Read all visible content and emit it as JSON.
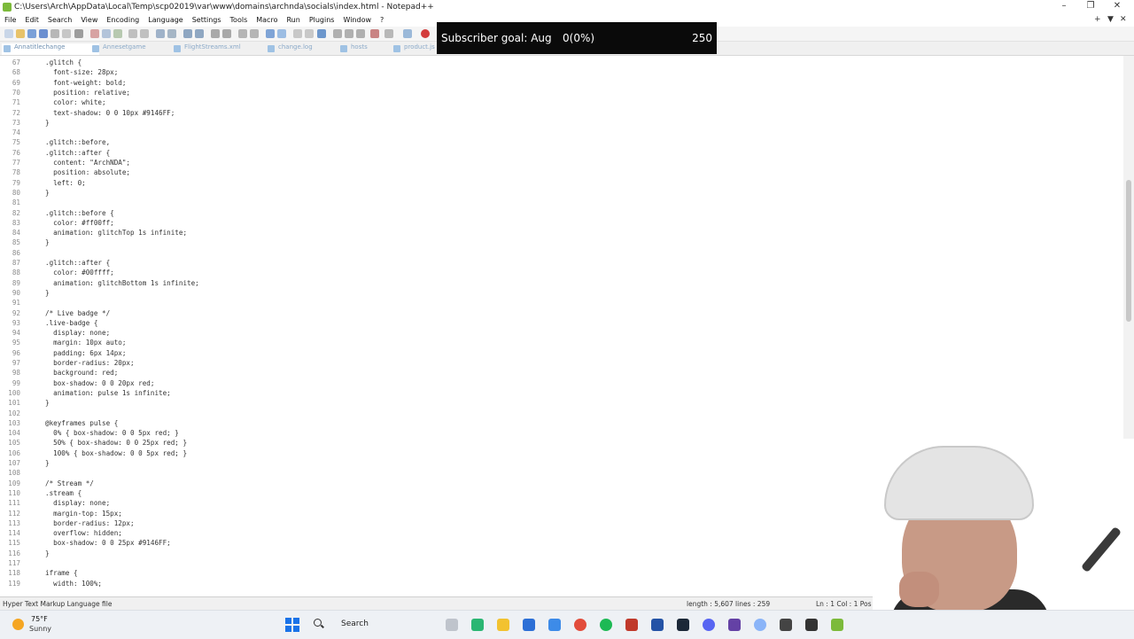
{
  "window": {
    "title": "C:\\Users\\Arch\\AppData\\Local\\Temp\\scp02019\\var\\www\\domains\\archnda\\socials\\index.html - Notepad++",
    "controls": [
      "–",
      "❐",
      "✕"
    ]
  },
  "menu": [
    "File",
    "Edit",
    "Search",
    "View",
    "Encoding",
    "Language",
    "Settings",
    "Tools",
    "Macro",
    "Run",
    "Plugins",
    "Window",
    "?"
  ],
  "menu_right": [
    "+",
    "▼",
    "✕"
  ],
  "tabs": [
    {
      "label": "Annatitlechange"
    },
    {
      "label": "Annesetgame"
    },
    {
      "label": "FlightStreams.xml"
    },
    {
      "label": "change.log"
    },
    {
      "label": "hosts"
    },
    {
      "label": "product.js"
    }
  ],
  "overlay": {
    "label": "Subscriber goal: Aug",
    "progress": "0(0%)",
    "goal": "250"
  },
  "code_lines": [
    {
      "n": "67",
      "t": ".glitch {"
    },
    {
      "n": "68",
      "t": "  font-size: 28px;"
    },
    {
      "n": "69",
      "t": "  font-weight: bold;"
    },
    {
      "n": "70",
      "t": "  position: relative;"
    },
    {
      "n": "71",
      "t": "  color: white;"
    },
    {
      "n": "72",
      "t": "  text-shadow: 0 0 10px #9146FF;"
    },
    {
      "n": "73",
      "t": "}"
    },
    {
      "n": "74",
      "t": ""
    },
    {
      "n": "75",
      "t": ".glitch::before,"
    },
    {
      "n": "76",
      "t": ".glitch::after {"
    },
    {
      "n": "77",
      "t": "  content: \"ArchNDA\";"
    },
    {
      "n": "78",
      "t": "  position: absolute;"
    },
    {
      "n": "79",
      "t": "  left: 0;"
    },
    {
      "n": "80",
      "t": "}"
    },
    {
      "n": "81",
      "t": ""
    },
    {
      "n": "82",
      "t": ".glitch::before {"
    },
    {
      "n": "83",
      "t": "  color: #ff00ff;"
    },
    {
      "n": "84",
      "t": "  animation: glitchTop 1s infinite;"
    },
    {
      "n": "85",
      "t": "}"
    },
    {
      "n": "86",
      "t": ""
    },
    {
      "n": "87",
      "t": ".glitch::after {"
    },
    {
      "n": "88",
      "t": "  color: #00ffff;"
    },
    {
      "n": "89",
      "t": "  animation: glitchBottom 1s infinite;"
    },
    {
      "n": "90",
      "t": "}"
    },
    {
      "n": "91",
      "t": ""
    },
    {
      "n": "92",
      "t": "/* Live badge */"
    },
    {
      "n": "93",
      "t": ".live-badge {"
    },
    {
      "n": "94",
      "t": "  display: none;"
    },
    {
      "n": "95",
      "t": "  margin: 10px auto;"
    },
    {
      "n": "96",
      "t": "  padding: 6px 14px;"
    },
    {
      "n": "97",
      "t": "  border-radius: 20px;"
    },
    {
      "n": "98",
      "t": "  background: red;"
    },
    {
      "n": "99",
      "t": "  box-shadow: 0 0 20px red;"
    },
    {
      "n": "100",
      "t": "  animation: pulse 1s infinite;"
    },
    {
      "n": "101",
      "t": "}"
    },
    {
      "n": "102",
      "t": ""
    },
    {
      "n": "103",
      "t": "@keyframes pulse {"
    },
    {
      "n": "104",
      "t": "  0% { box-shadow: 0 0 5px red; }"
    },
    {
      "n": "105",
      "t": "  50% { box-shadow: 0 0 25px red; }"
    },
    {
      "n": "106",
      "t": "  100% { box-shadow: 0 0 5px red; }"
    },
    {
      "n": "107",
      "t": "}"
    },
    {
      "n": "108",
      "t": ""
    },
    {
      "n": "109",
      "t": "/* Stream */"
    },
    {
      "n": "110",
      "t": ".stream {"
    },
    {
      "n": "111",
      "t": "  display: none;"
    },
    {
      "n": "112",
      "t": "  margin-top: 15px;"
    },
    {
      "n": "113",
      "t": "  border-radius: 12px;"
    },
    {
      "n": "114",
      "t": "  overflow: hidden;"
    },
    {
      "n": "115",
      "t": "  box-shadow: 0 0 25px #9146FF;"
    },
    {
      "n": "116",
      "t": "}"
    },
    {
      "n": "117",
      "t": ""
    },
    {
      "n": "118",
      "t": "iframe {"
    },
    {
      "n": "119",
      "t": "  width: 100%;"
    }
  ],
  "status": {
    "file_type": "Hyper Text Markup Language file",
    "length_lines": "length : 5,607    lines : 259",
    "position": "Ln : 1    Col : 1    Pos : 1"
  },
  "taskbar": {
    "temperature": "75°F",
    "condition": "Sunny",
    "search_label": "Search"
  },
  "colors": {
    "accent": "#1a73e8",
    "overlay_bg": "#0a0a0a",
    "tab_text": "#8aa9c8"
  }
}
